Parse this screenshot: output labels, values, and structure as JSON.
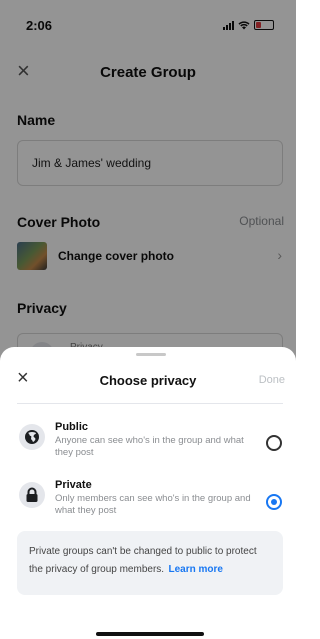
{
  "status_bar": {
    "time": "2:06"
  },
  "header": {
    "title": "Create Group"
  },
  "form": {
    "name_label": "Name",
    "name_value": "Jim & James' wedding",
    "cover_label": "Cover Photo",
    "cover_optional": "Optional",
    "cover_action": "Change cover photo",
    "privacy_label": "Privacy",
    "privacy_field_text": "Privacy"
  },
  "sheet": {
    "title": "Choose privacy",
    "done_label": "Done",
    "options": [
      {
        "title": "Public",
        "description": "Anyone can see who's in the group and what they post",
        "selected": false,
        "icon": "globe-icon"
      },
      {
        "title": "Private",
        "description": "Only members can see who's in the group and what they post",
        "selected": true,
        "icon": "lock-icon"
      }
    ],
    "info_text": "Private groups can't be changed to public to protect the privacy of group members.",
    "info_link": "Learn more"
  },
  "colors": {
    "accent": "#1877f2",
    "info_bg": "#f0f2f5",
    "dim": "rgba(0,0,0,0.42)"
  }
}
